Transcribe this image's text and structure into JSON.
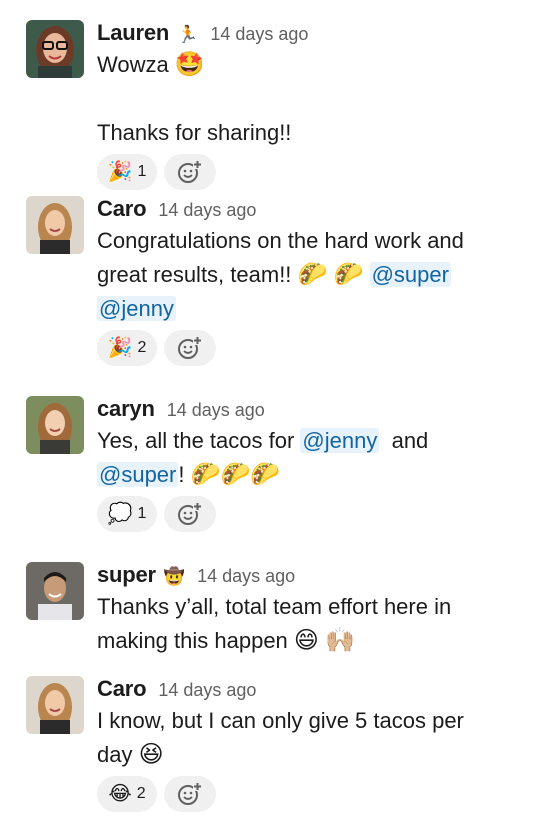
{
  "messages": [
    {
      "author": "Lauren",
      "status_emoji": "🏃",
      "timestamp": "14 days ago",
      "lines": [
        [
          {
            "t": "text",
            "v": "Wowza "
          },
          {
            "t": "emoji",
            "v": "🤩"
          }
        ],
        [
          {
            "t": "text",
            "v": ""
          }
        ],
        [
          {
            "t": "text",
            "v": "Thanks for sharing!!"
          }
        ]
      ],
      "reactions": [
        {
          "emoji": "🎉",
          "count": "1"
        }
      ],
      "avatar_bg": "#6b4a3a"
    },
    {
      "author": "Caro",
      "status_emoji": "",
      "timestamp": "14 days ago",
      "lines": [
        [
          {
            "t": "text",
            "v": "Congratulations on the hard work and"
          }
        ],
        [
          {
            "t": "text",
            "v": "great results, team!! "
          },
          {
            "t": "emoji",
            "v": "🌮"
          },
          {
            "t": "text",
            "v": " "
          },
          {
            "t": "emoji",
            "v": "🌮"
          },
          {
            "t": "text",
            "v": " "
          },
          {
            "t": "mention",
            "v": "@super"
          }
        ],
        [
          {
            "t": "mention",
            "v": "@jenny"
          }
        ]
      ],
      "reactions": [
        {
          "emoji": "🎉",
          "count": "2"
        }
      ],
      "avatar_bg": "#c9b8a3"
    },
    {
      "author": "caryn",
      "status_emoji": "",
      "timestamp": "14 days ago",
      "lines": [
        [
          {
            "t": "text",
            "v": "Yes, all the tacos for "
          },
          {
            "t": "mention",
            "v": "@jenny"
          },
          {
            "t": "text",
            "v": "  and"
          }
        ],
        [
          {
            "t": "mention",
            "v": "@super"
          },
          {
            "t": "text",
            "v": "! "
          },
          {
            "t": "emoji",
            "v": "🌮🌮🌮"
          }
        ]
      ],
      "reactions": [
        {
          "emoji": "💭",
          "count": "1"
        }
      ],
      "avatar_bg": "#8c9a6e"
    },
    {
      "author": "super",
      "status_emoji": "🤠",
      "timestamp": "14 days ago",
      "lines": [
        [
          {
            "t": "text",
            "v": "Thanks y’all, total team effort here in"
          }
        ],
        [
          {
            "t": "text",
            "v": "making this happen "
          },
          {
            "t": "emoji",
            "v": "😄"
          },
          {
            "t": "text",
            "v": " "
          },
          {
            "t": "emoji",
            "v": "🙌🏼"
          }
        ]
      ],
      "reactions": [],
      "avatar_bg": "#6d6a66"
    },
    {
      "author": "Caro",
      "status_emoji": "",
      "timestamp": "14 days ago",
      "lines": [
        [
          {
            "t": "text",
            "v": "I know, but I can only give 5 tacos per"
          }
        ],
        [
          {
            "t": "text",
            "v": "day "
          },
          {
            "t": "emoji",
            "v": "😆"
          }
        ]
      ],
      "reactions": [
        {
          "emoji": "😂",
          "count": "2"
        }
      ],
      "avatar_bg": "#c9b8a3"
    }
  ],
  "add_reaction_icon": "add-reaction-icon",
  "colors": {
    "mention_text": "#1264a3",
    "mention_bg": "#e8f2fa",
    "timestamp": "#616061",
    "pill_bg": "#f0f0f0"
  }
}
